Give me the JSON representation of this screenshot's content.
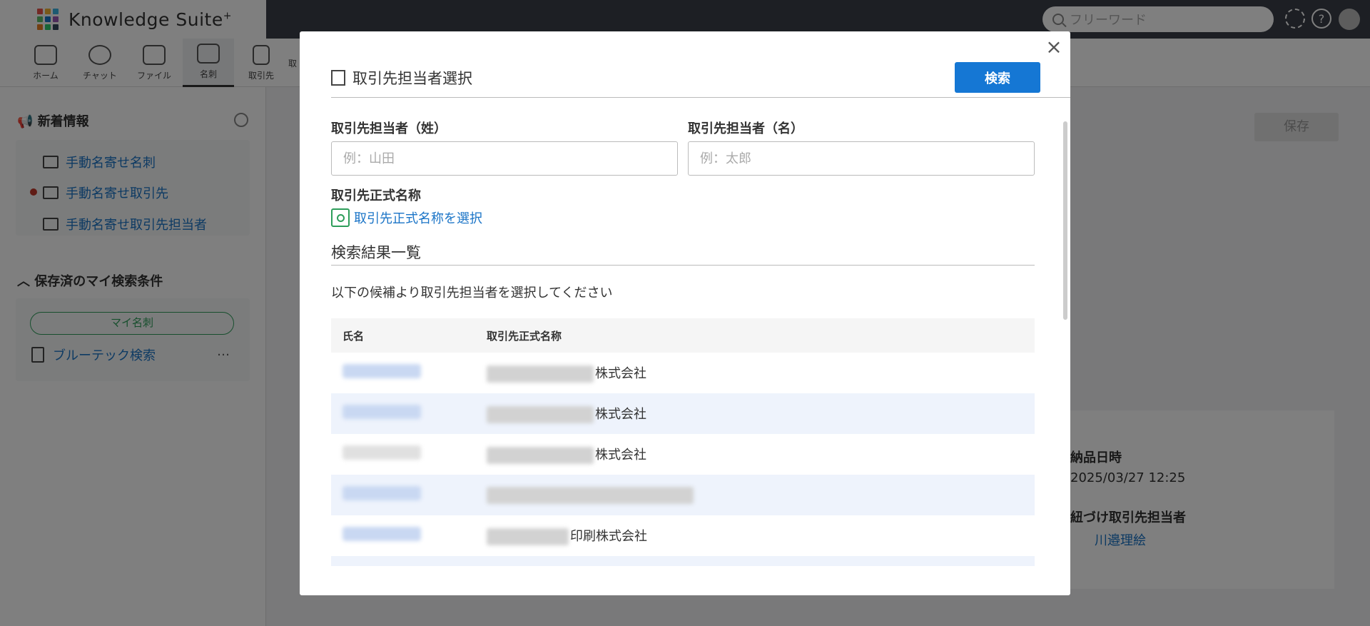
{
  "app": {
    "title": "Knowledge Suite",
    "title_sup": "+",
    "logo_colors": [
      "#e8534a",
      "#f2b233",
      "#3bb4e5",
      "#5fbf6b",
      "#1b76c8",
      "#9b59b6",
      "#e67e22",
      "#2ecc71",
      "#34495e"
    ]
  },
  "header": {
    "search_placeholder": "フリーワード"
  },
  "nav": {
    "items": [
      {
        "label": "ホーム"
      },
      {
        "label": "チャット"
      },
      {
        "label": "ファイル"
      },
      {
        "label": "名刺"
      },
      {
        "label": "取引先"
      },
      {
        "label": "取"
      }
    ]
  },
  "sidebar": {
    "news_title": "新着情報",
    "news_items": [
      {
        "label": "手動名寄せ名刺"
      },
      {
        "label": "手動名寄せ取引先"
      },
      {
        "label": "手動名寄せ取引先担当者"
      }
    ],
    "saved_title": "保存済のマイ検索条件",
    "my_card_button": "マイ名刺",
    "saved_search": "ブルーテック検索",
    "more": "…"
  },
  "background": {
    "save_button": "保存",
    "delivery_label": "納品日時",
    "delivery_value": "2025/03/27 12:25",
    "linked_label": "紐づけ取引先担当者",
    "linked_value": "川邉理絵"
  },
  "modal": {
    "title": "取引先担当者選択",
    "search_button": "検索",
    "close": "×",
    "last_name_label": "取引先担当者（姓）",
    "last_name_placeholder": "例：山田",
    "first_name_label": "取引先担当者（名）",
    "first_name_placeholder": "例：太郎",
    "company_label": "取引先正式名称",
    "company_select_link": "取引先正式名称を選択",
    "results_title": "検索結果一覧",
    "results_hint": "以下の候補より取引先担当者を選択してください",
    "table": {
      "headers": [
        "氏名",
        "取引先正式名称"
      ],
      "rows": [
        {
          "company_suffix": "株式会社"
        },
        {
          "company_suffix": "株式会社"
        },
        {
          "company_suffix": "株式会社"
        },
        {
          "company_suffix": ""
        },
        {
          "company_suffix": "印刷株式会社"
        }
      ]
    }
  }
}
